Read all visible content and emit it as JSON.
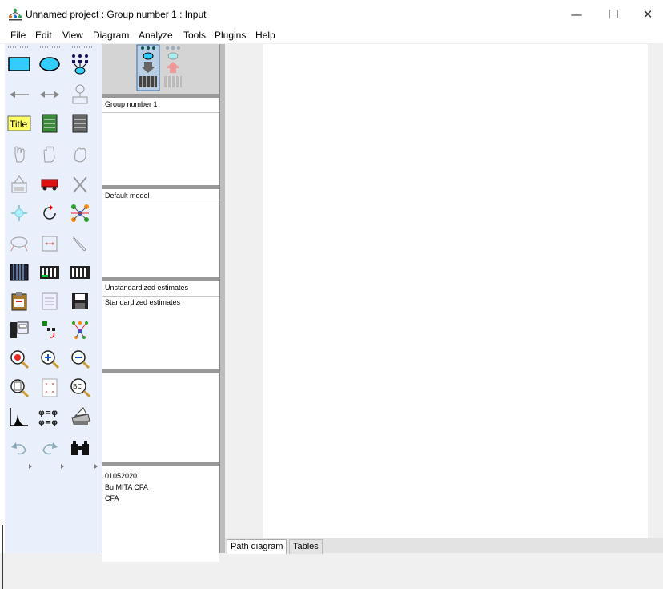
{
  "window": {
    "title": "Unnamed project : Group number 1 : Input",
    "controls": {
      "minimize": "—",
      "maximize": "☐",
      "close": "✕"
    }
  },
  "menu": [
    "File",
    "Edit",
    "View",
    "Diagram",
    "Analyze",
    "Tools",
    "Plugins",
    "Help"
  ],
  "toolbox": {
    "title_tool_label": "Title",
    "icons": [
      "draw-observed-variable-icon",
      "draw-unobserved-variable-icon",
      "draw-latent-indicator-icon",
      "draw-path-icon",
      "draw-covariance-icon",
      "unique-variable-icon",
      "figure-caption-icon",
      "list-variables-in-model-icon",
      "list-variables-in-dataset-icon",
      "select-one-object-icon",
      "select-all-objects-icon",
      "deselect-all-objects-icon",
      "duplicate-objects-icon",
      "move-objects-icon",
      "erase-objects-icon",
      "change-shape-icon",
      "rotate-indicators-icon",
      "reflect-indicators-icon",
      "move-parameter-values-icon",
      "reposition-diagram-icon",
      "touch-up-variable-icon",
      "select-data-files-icon",
      "analysis-properties-icon",
      "calculate-estimates-icon",
      "copy-to-clipboard-icon",
      "view-text-icon",
      "save-diagram-icon",
      "object-properties-icon",
      "drag-properties-icon",
      "preserve-symmetries-icon",
      "zoom-in-area-icon",
      "zoom-in-icon",
      "zoom-out-icon",
      "view-page-icon",
      "fit-to-page-icon",
      "loupe-icon",
      "bayesian-estimation-icon",
      "multiple-group-analysis-icon",
      "print-diagram-icon",
      "undo-icon",
      "redo-icon",
      "specification-search-icon"
    ]
  },
  "panels": {
    "groups": {
      "header": "Group number 1"
    },
    "models": {
      "header": "Default model"
    },
    "estimates": {
      "items": [
        "Unstandardized estimates",
        "Standardized estimates"
      ]
    },
    "files": {
      "items": [
        "01052020",
        "Bu MITA CFA",
        "CFA"
      ]
    }
  },
  "tabs": {
    "path_diagram": "Path diagram",
    "tables": "Tables"
  },
  "colors": {
    "rectangle": "#33ccff",
    "ellipse": "#33ccff",
    "title_bg": "#ffff66",
    "toolbox_bg": "#e9f0fb"
  }
}
